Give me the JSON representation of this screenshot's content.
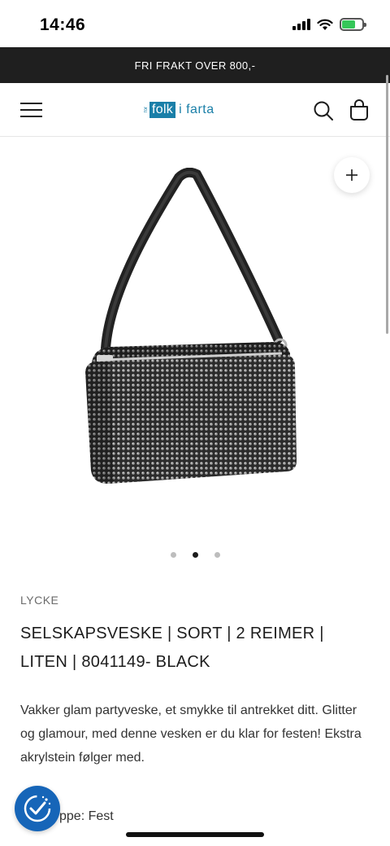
{
  "status": {
    "time": "14:46"
  },
  "announcement": "FRI FRAKT OVER 800,-",
  "header": {
    "logo": {
      "prefix": "for",
      "highlight": "folk",
      "rest": "i farta"
    }
  },
  "gallery": {
    "slides": 3,
    "active_slide": 2
  },
  "product": {
    "brand": "LYCKE",
    "title": "SELSKAPSVESKE | SORT | 2 REIMER | LITEN | 8041149- BLACK",
    "description": "Vakker glam partyveske, et smykke til antrekket ditt. Glitter og glamour, med denne vesken er du klar for festen! Ekstra akrylstein følger med.",
    "group_partial": "ppe: Fest"
  },
  "colors": {
    "announcement_bg": "#1f1f1f",
    "brand_blue": "#1a7fa8",
    "accessibility_blue": "#1665b8"
  },
  "icons": [
    "signal-icon",
    "wifi-icon",
    "battery-icon",
    "menu-icon",
    "search-icon",
    "bag-icon",
    "plus-icon",
    "accessibility-icon"
  ]
}
